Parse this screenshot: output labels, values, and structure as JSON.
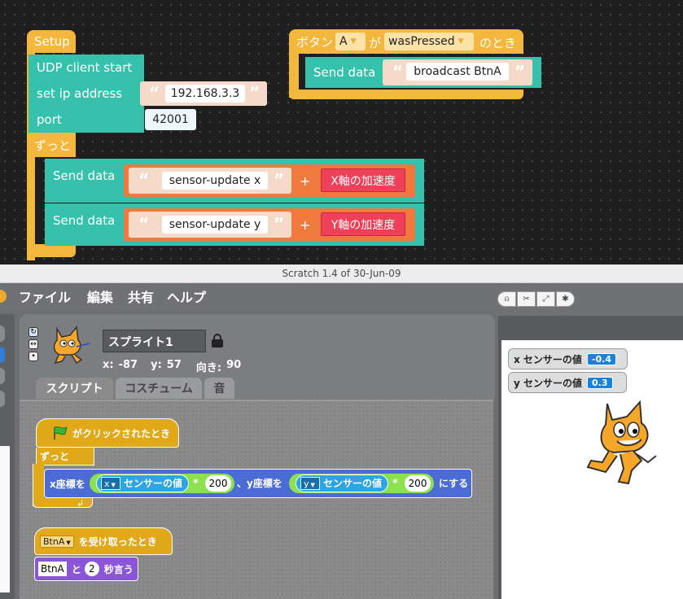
{
  "blocks": {
    "setup_hat": "Setup",
    "udp_start": "UDP client start",
    "set_ip": "set ip address",
    "ip_value": "192.168.3.3",
    "port": "port",
    "port_value": "42001",
    "forever": "ずっと",
    "send_data": "Send data",
    "sensor_x": "sensor-update x",
    "sensor_y": "sensor-update y",
    "plus": "+",
    "x_accel": "X軸の加速度",
    "y_accel": "Y軸の加速度",
    "button_hat": {
      "prefix": "ボタン",
      "button": "A",
      "ga": "が",
      "event": "wasPressed",
      "suffix": "のとき"
    },
    "broadcast_value": "broadcast BtnA",
    "quote_open": "“",
    "quote_close": "”"
  },
  "window": {
    "title": "Scratch 1.4 of 30-Jun-09"
  },
  "menu": {
    "file": "ファイル",
    "edit": "編集",
    "share": "共有",
    "help": "ヘルプ"
  },
  "sprite": {
    "name": "スプライト1",
    "x_label": "x:",
    "x": "-87",
    "y_label": "y:",
    "y": "57",
    "dir_label": "向き:",
    "direction": "90"
  },
  "tabs": {
    "scripts": "スクリプト",
    "costumes": "コスチューム",
    "sounds": "音"
  },
  "scripts": {
    "flag_hat": "がクリックされたとき",
    "forever": "ずっと",
    "go_x": "x座標を",
    "sensor_value": "センサーの値",
    "x_menu": "x",
    "y_menu": "y",
    "times": "*",
    "multiplier": "200",
    "go_y": "、y座標を",
    "go_end": "にする",
    "receive_menu": "BtnA",
    "receive_label": "を受け取ったとき",
    "say_value": "BtnA",
    "to": "と",
    "seconds": "2",
    "say_label": "秒言う"
  },
  "monitors": [
    {
      "label": "x センサーの値",
      "value": "-0.4"
    },
    {
      "label": "y センサーの値",
      "value": "0.3"
    }
  ],
  "colors": {
    "event": "#f3b73d",
    "command": "#36c1ad",
    "string_slot": "#f5d9c9",
    "join": "#f07a3d",
    "accel": "#ef4059",
    "motion": "#4a6cd4",
    "sensing": "#2ca5e2",
    "operator": "#62c213",
    "control": "#e1a91a",
    "looks": "#8a55d7"
  }
}
